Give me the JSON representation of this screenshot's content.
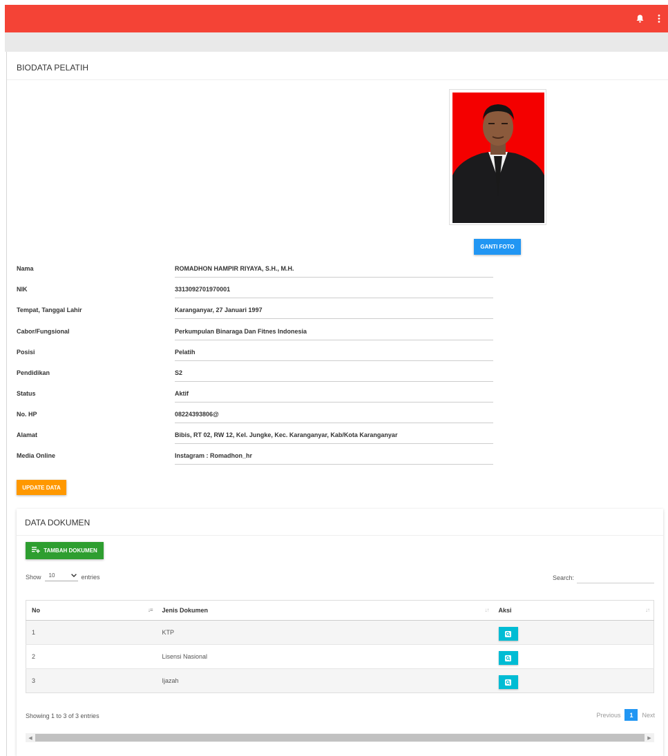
{
  "header": {
    "title": "BIODATA PELATIH"
  },
  "photo": {
    "button_label": "GANTI FOTO"
  },
  "fields": [
    {
      "label": "Nama",
      "value": "ROMADHON HAMPIR RIYAYA, S.H., M.H."
    },
    {
      "label": "NIK",
      "value": "3313092701970001"
    },
    {
      "label": "Tempat, Tanggal Lahir",
      "value": "Karanganyar, 27 Januari 1997"
    },
    {
      "label": "Cabor/Fungsional",
      "value": "Perkumpulan Binaraga Dan Fitnes Indonesia"
    },
    {
      "label": "Posisi",
      "value": "Pelatih"
    },
    {
      "label": "Pendidikan",
      "value": "S2"
    },
    {
      "label": "Status",
      "value": "Aktif"
    },
    {
      "label": "No. HP",
      "value": "08224393806@"
    },
    {
      "label": "Alamat",
      "value": "Bibis, RT 02, RW 12, Kel. Jungke, Kec. Karanganyar, Kab/Kota Karanganyar"
    },
    {
      "label": "Media Online",
      "value": "Instagram : Romadhon_hr"
    }
  ],
  "update_button": "UPDATE DATA",
  "documents": {
    "title": "DATA DOKUMEN",
    "add_button": "TAMBAH DOKUMEN",
    "show_label": "Show",
    "entries_label": "entries",
    "page_length": "10",
    "search_label": "Search:",
    "search_value": "",
    "columns": [
      "No",
      "Jenis Dokumen",
      "Aksi"
    ],
    "rows": [
      {
        "no": "1",
        "jenis": "KTP"
      },
      {
        "no": "2",
        "jenis": "Lisensi Nasional"
      },
      {
        "no": "3",
        "jenis": "Ijazah"
      }
    ],
    "info": "Showing 1 to 3 of 3 entries",
    "pagination": {
      "previous": "Previous",
      "current": "1",
      "next": "Next"
    }
  },
  "colors": {
    "topbar": "#f44336",
    "primary": "#2196f3",
    "warning": "#ff9800",
    "success": "#2e9e30",
    "info": "#00bcd4"
  },
  "icons": [
    "bell-icon",
    "more-vert-icon",
    "playlist-add-icon",
    "search-icon",
    "sort-icon",
    "chevron-down-icon",
    "scroll-left-icon",
    "scroll-right-icon"
  ]
}
